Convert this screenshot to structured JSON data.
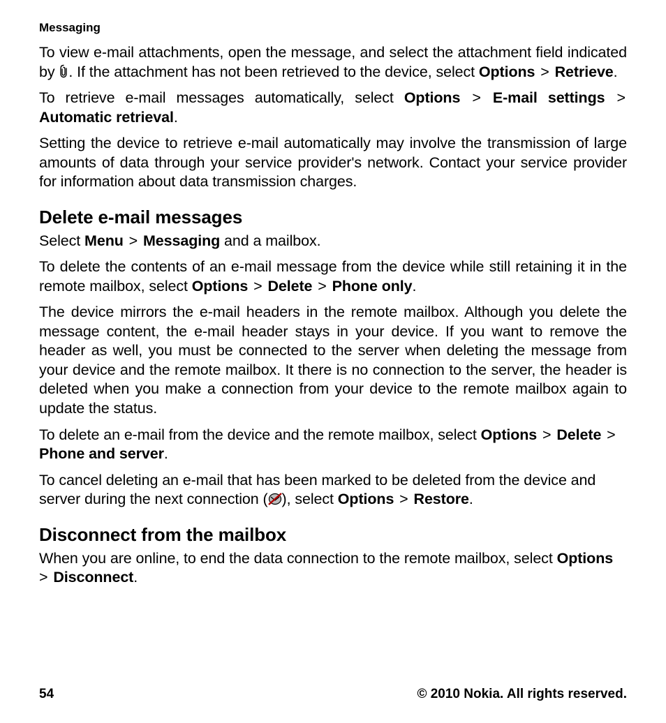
{
  "header": {
    "title": "Messaging"
  },
  "intro": {
    "p1a": "To view e-mail attachments, open the message, and select the attachment field indicated by ",
    "p1b": ". If the attachment has not been retrieved to the device, select ",
    "p1_options": "Options",
    "p1_gt": " > ",
    "p1_retrieve": "Retrieve",
    "p1_end": ".",
    "p2a": "To retrieve e-mail messages automatically, select ",
    "p2_options": "Options",
    "p2_gt1": " > ",
    "p2_emailsettings": "E-mail settings",
    "p2_gt2": " > ",
    "p2_autoretrieval": "Automatic retrieval",
    "p2_end": ".",
    "p3": "Setting the device to retrieve e-mail automatically may involve the transmission of large amounts of data through your service provider's network. Contact your service provider for information about data transmission charges."
  },
  "section1": {
    "heading": "Delete e-mail messages",
    "p1a": "Select ",
    "p1_menu": "Menu",
    "p1_gt": " > ",
    "p1_messaging": "Messaging",
    "p1b": " and a mailbox.",
    "p2a": "To delete the contents of an e-mail message from the device while still retaining it in the remote mailbox, select ",
    "p2_options": "Options",
    "p2_gt1": " > ",
    "p2_delete": "Delete",
    "p2_gt2": " > ",
    "p2_phoneonly": "Phone only",
    "p2_end": ".",
    "p3": "The device mirrors the e-mail headers in the remote mailbox. Although you delete the message content, the e-mail header stays in your device. If you want to remove the header as well, you must be connected to the server when deleting the message from your device and the remote mailbox. It there is no connection to the server, the header is deleted when you make a connection from your device to the remote mailbox again to update the status.",
    "p4a": "To delete an e-mail from the device and the remote mailbox, select ",
    "p4_options": "Options",
    "p4_gt1": " > ",
    "p4_delete": "Delete",
    "p4_gt2": " > ",
    "p4_phoneserver": "Phone and server",
    "p4_end": ".",
    "p5a": "To cancel deleting an e-mail that has been marked to be deleted from the device and server during the next connection (",
    "p5b": "), select ",
    "p5_options": "Options",
    "p5_gt": " > ",
    "p5_restore": "Restore",
    "p5_end": "."
  },
  "section2": {
    "heading": "Disconnect from the mailbox",
    "p1a": "When you are online, to end the data connection to the remote mailbox, select ",
    "p1_options": "Options",
    "p1_gt": " > ",
    "p1_disconnect": "Disconnect",
    "p1_end": "."
  },
  "footer": {
    "page": "54",
    "copyright": "© 2010 Nokia. All rights reserved."
  }
}
